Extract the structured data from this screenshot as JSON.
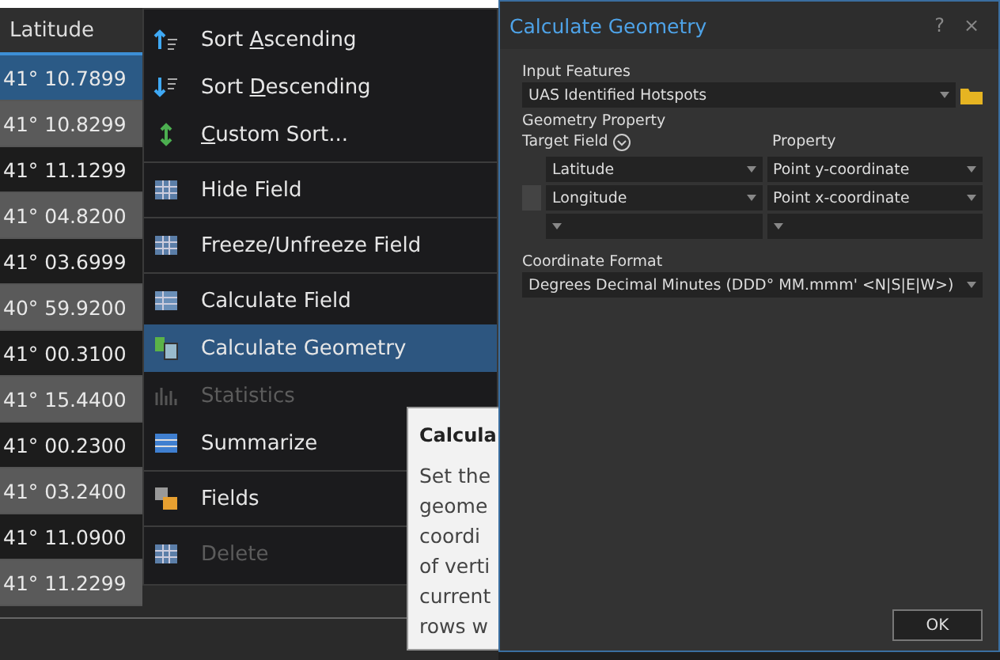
{
  "table": {
    "header": "Latitude",
    "rows": [
      {
        "value": "41° 10.7899",
        "selected": true
      },
      {
        "value": "41° 10.8299",
        "selected": false
      },
      {
        "value": "41° 11.1299",
        "selected": false
      },
      {
        "value": "41° 04.8200",
        "selected": false
      },
      {
        "value": "41° 03.6999",
        "selected": false
      },
      {
        "value": "40° 59.9200",
        "selected": false
      },
      {
        "value": "41° 00.3100",
        "selected": false
      },
      {
        "value": "41° 15.4400",
        "selected": false
      },
      {
        "value": "41° 00.2300",
        "selected": false
      },
      {
        "value": "41° 03.2400",
        "selected": false
      },
      {
        "value": "41° 11.0900",
        "selected": false
      },
      {
        "value": "41° 11.2299",
        "selected": false
      }
    ]
  },
  "context_menu": {
    "items": [
      {
        "kind": "item",
        "before": "Sort ",
        "accel": "A",
        "after": "scending",
        "selected": false,
        "disabled": false
      },
      {
        "kind": "item",
        "before": "Sort ",
        "accel": "D",
        "after": "escending",
        "selected": false,
        "disabled": false
      },
      {
        "kind": "item",
        "accel": "C",
        "after": "ustom Sort...",
        "selected": false,
        "disabled": false
      },
      {
        "kind": "separator"
      },
      {
        "kind": "item",
        "before": "Hide Field",
        "selected": false,
        "disabled": false
      },
      {
        "kind": "separator"
      },
      {
        "kind": "item",
        "before": "Freeze/Unfreeze Field",
        "selected": false,
        "disabled": false
      },
      {
        "kind": "separator"
      },
      {
        "kind": "item",
        "before": "Calculate Field",
        "selected": false,
        "disabled": false
      },
      {
        "kind": "item",
        "before": "Calculate Geometry",
        "selected": true,
        "disabled": false
      },
      {
        "kind": "item",
        "before": "Statistics",
        "selected": false,
        "disabled": true
      },
      {
        "kind": "item",
        "before": "Summarize",
        "selected": false,
        "disabled": false
      },
      {
        "kind": "separator"
      },
      {
        "kind": "item",
        "before": "Fields",
        "selected": false,
        "disabled": false
      },
      {
        "kind": "separator"
      },
      {
        "kind": "item",
        "before": "Delete",
        "selected": false,
        "disabled": true
      }
    ]
  },
  "tooltip": {
    "title": "Calcula",
    "lines": [
      "Set the",
      "geome",
      "coordi",
      "of verti",
      "current",
      "rows w"
    ]
  },
  "dialog": {
    "title": "Calculate Geometry",
    "help": "?",
    "close": "×",
    "input_features": {
      "label": "Input Features",
      "value": "UAS Identified Hotspots"
    },
    "geometry_property": "Geometry Property",
    "target_field_label": "Target Field",
    "property_label": "Property",
    "rows": [
      {
        "field": "Latitude",
        "property": "Point y-coordinate"
      },
      {
        "field": "Longitude",
        "property": "Point x-coordinate"
      },
      {}
    ],
    "coordinate_format": {
      "label": "Coordinate Format",
      "value": "Degrees Decimal Minutes (DDD° MM.mmm' <N|S|E|W>)"
    },
    "ok": "OK"
  }
}
